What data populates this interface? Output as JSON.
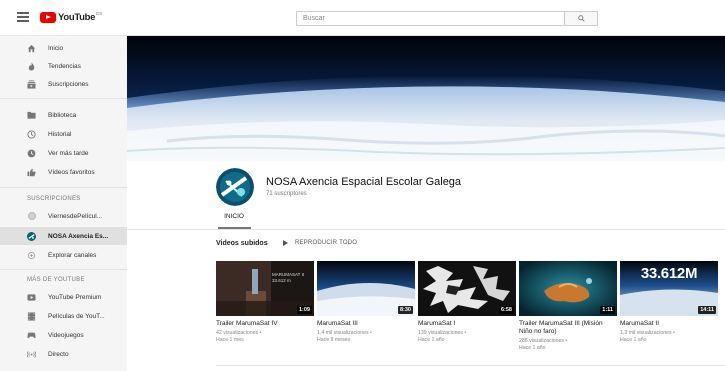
{
  "topbar": {
    "logo_text": "YouTube",
    "logo_sup": "ES",
    "search_placeholder": "Buscar"
  },
  "sidebar": {
    "main": [
      {
        "label": "Inicio",
        "icon": "home-icon"
      },
      {
        "label": "Tendencias",
        "icon": "trending-icon"
      },
      {
        "label": "Suscripciones",
        "icon": "subscriptions-icon"
      }
    ],
    "library": [
      {
        "label": "Biblioteca",
        "icon": "library-icon"
      },
      {
        "label": "Historial",
        "icon": "history-icon"
      },
      {
        "label": "Ver más tarde",
        "icon": "watch-later-icon"
      },
      {
        "label": "Vídeos favoritos",
        "icon": "liked-icon"
      }
    ],
    "subs_heading": "SUSCRIPCIONES",
    "subscriptions": [
      {
        "label": "ViernesdePelícul..."
      },
      {
        "label": "NOSA Axencia Es...",
        "active": true
      },
      {
        "label": "Explorar canales"
      }
    ],
    "more_heading": "MÁS DE YOUTUBE",
    "more": [
      {
        "label": "YouTube Premium",
        "icon": "premium-icon"
      },
      {
        "label": "Películas de YouT...",
        "icon": "movies-icon"
      },
      {
        "label": "Videojuegos",
        "icon": "gaming-icon"
      },
      {
        "label": "Directo",
        "icon": "live-icon"
      }
    ]
  },
  "channel": {
    "name": "NOSA Axencia Espacial Escolar Galega",
    "subscribers": "71 suscriptores",
    "tab": "INICIO"
  },
  "section": {
    "title": "Videos subidos",
    "play_all": "REPRODUCIR TODO"
  },
  "videos": [
    {
      "title": "Trailer MarumaSat IV",
      "views": "42 visualizaciones •",
      "age": "Hace 1 mes",
      "duration": "1:09",
      "overlay": "MARUMASAT II",
      "overlay2": "33.612 m"
    },
    {
      "title": "MarumaSat III",
      "views": "1,4 mil visualizaciones •",
      "age": "Hace 9 meses",
      "duration": "8:30"
    },
    {
      "title": "MarumaSat I",
      "views": "139 visualizaciones •",
      "age": "Hace 1 año",
      "duration": "6:58"
    },
    {
      "title": "Trailer MarumaSat III (Misión Niño no faro)",
      "views": "286 visualizaciones •",
      "age": "Hace 1 año",
      "duration": "1:11"
    },
    {
      "title": "MarumaSat II",
      "views": "1,3 mil visualizaciones •",
      "age": "Hace 1 año",
      "duration": "14:11",
      "overlay": "33.612M"
    }
  ]
}
